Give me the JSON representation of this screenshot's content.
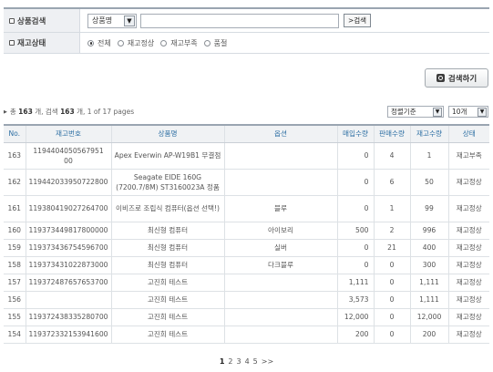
{
  "search": {
    "label": "상품검색",
    "field_value": "상품명",
    "field_arrow": "▼",
    "input_value": "",
    "button_label": ">검색"
  },
  "stock_filter": {
    "label": "재고상태",
    "options": [
      "전체",
      "재고정상",
      "재고부족",
      "품절"
    ],
    "selected": "전체"
  },
  "big_search_label": "검색하기",
  "summary": {
    "prefix": "총",
    "total": "163",
    "mid": "개, 검색",
    "found": "163",
    "suffix": "개, 1 of 17 pages"
  },
  "sort": {
    "value": "정렬기준",
    "arrow": "▼"
  },
  "per_page": {
    "value": "10개",
    "arrow": "▼"
  },
  "table": {
    "headers": [
      "No.",
      "재고번호",
      "상품명",
      "옵션",
      "매입수량",
      "판매수량",
      "재고수량",
      "상태"
    ],
    "rows": [
      {
        "no": "163",
        "code": "1194404050567951 00",
        "name": "Apex Everwin AP-W19B1 무결점",
        "option": "",
        "buy": "0",
        "sold": "4",
        "stock": "1",
        "status": "재고부족"
      },
      {
        "no": "162",
        "code": "119442033950722800",
        "name": "Seagate EIDE 160G (7200.7/8M) ST3160023A 정품",
        "option": "",
        "buy": "0",
        "sold": "6",
        "stock": "50",
        "status": "재고정상"
      },
      {
        "no": "161",
        "code": "119380419027264700",
        "name": "이비즈로 조립식 컴퓨터(옵션 선택!)",
        "option": "블루",
        "buy": "0",
        "sold": "1",
        "stock": "99",
        "status": "재고정상"
      },
      {
        "no": "160",
        "code": "119373449817800000",
        "name": "최신형 컴퓨터",
        "option": "아이보리",
        "buy": "500",
        "sold": "2",
        "stock": "996",
        "status": "재고정상"
      },
      {
        "no": "159",
        "code": "119373436754596700",
        "name": "최신형 컴퓨터",
        "option": "실버",
        "buy": "0",
        "sold": "21",
        "stock": "400",
        "status": "재고정상"
      },
      {
        "no": "158",
        "code": "119373431022873000",
        "name": "최신형 컴퓨터",
        "option": "다크블루",
        "buy": "0",
        "sold": "0",
        "stock": "300",
        "status": "재고정상"
      },
      {
        "no": "157",
        "code": "119372487657653700",
        "name": "고진희 테스트",
        "option": "",
        "buy": "1,111",
        "sold": "0",
        "stock": "1,111",
        "status": "재고정상"
      },
      {
        "no": "156",
        "code": "",
        "name": "고진희 테스트",
        "option": "",
        "buy": "3,573",
        "sold": "0",
        "stock": "1,111",
        "status": "재고정상"
      },
      {
        "no": "155",
        "code": "119372438335280700",
        "name": "고진희 테스트",
        "option": "",
        "buy": "12,000",
        "sold": "0",
        "stock": "12,000",
        "status": "재고정상"
      },
      {
        "no": "154",
        "code": "119372332153941600",
        "name": "고진희 테스트",
        "option": "",
        "buy": "200",
        "sold": "0",
        "stock": "200",
        "status": "재고정상"
      }
    ]
  },
  "pagination": {
    "pages": [
      "1",
      "2",
      "3",
      "4",
      "5"
    ],
    "current": "1",
    "next": ">>"
  }
}
